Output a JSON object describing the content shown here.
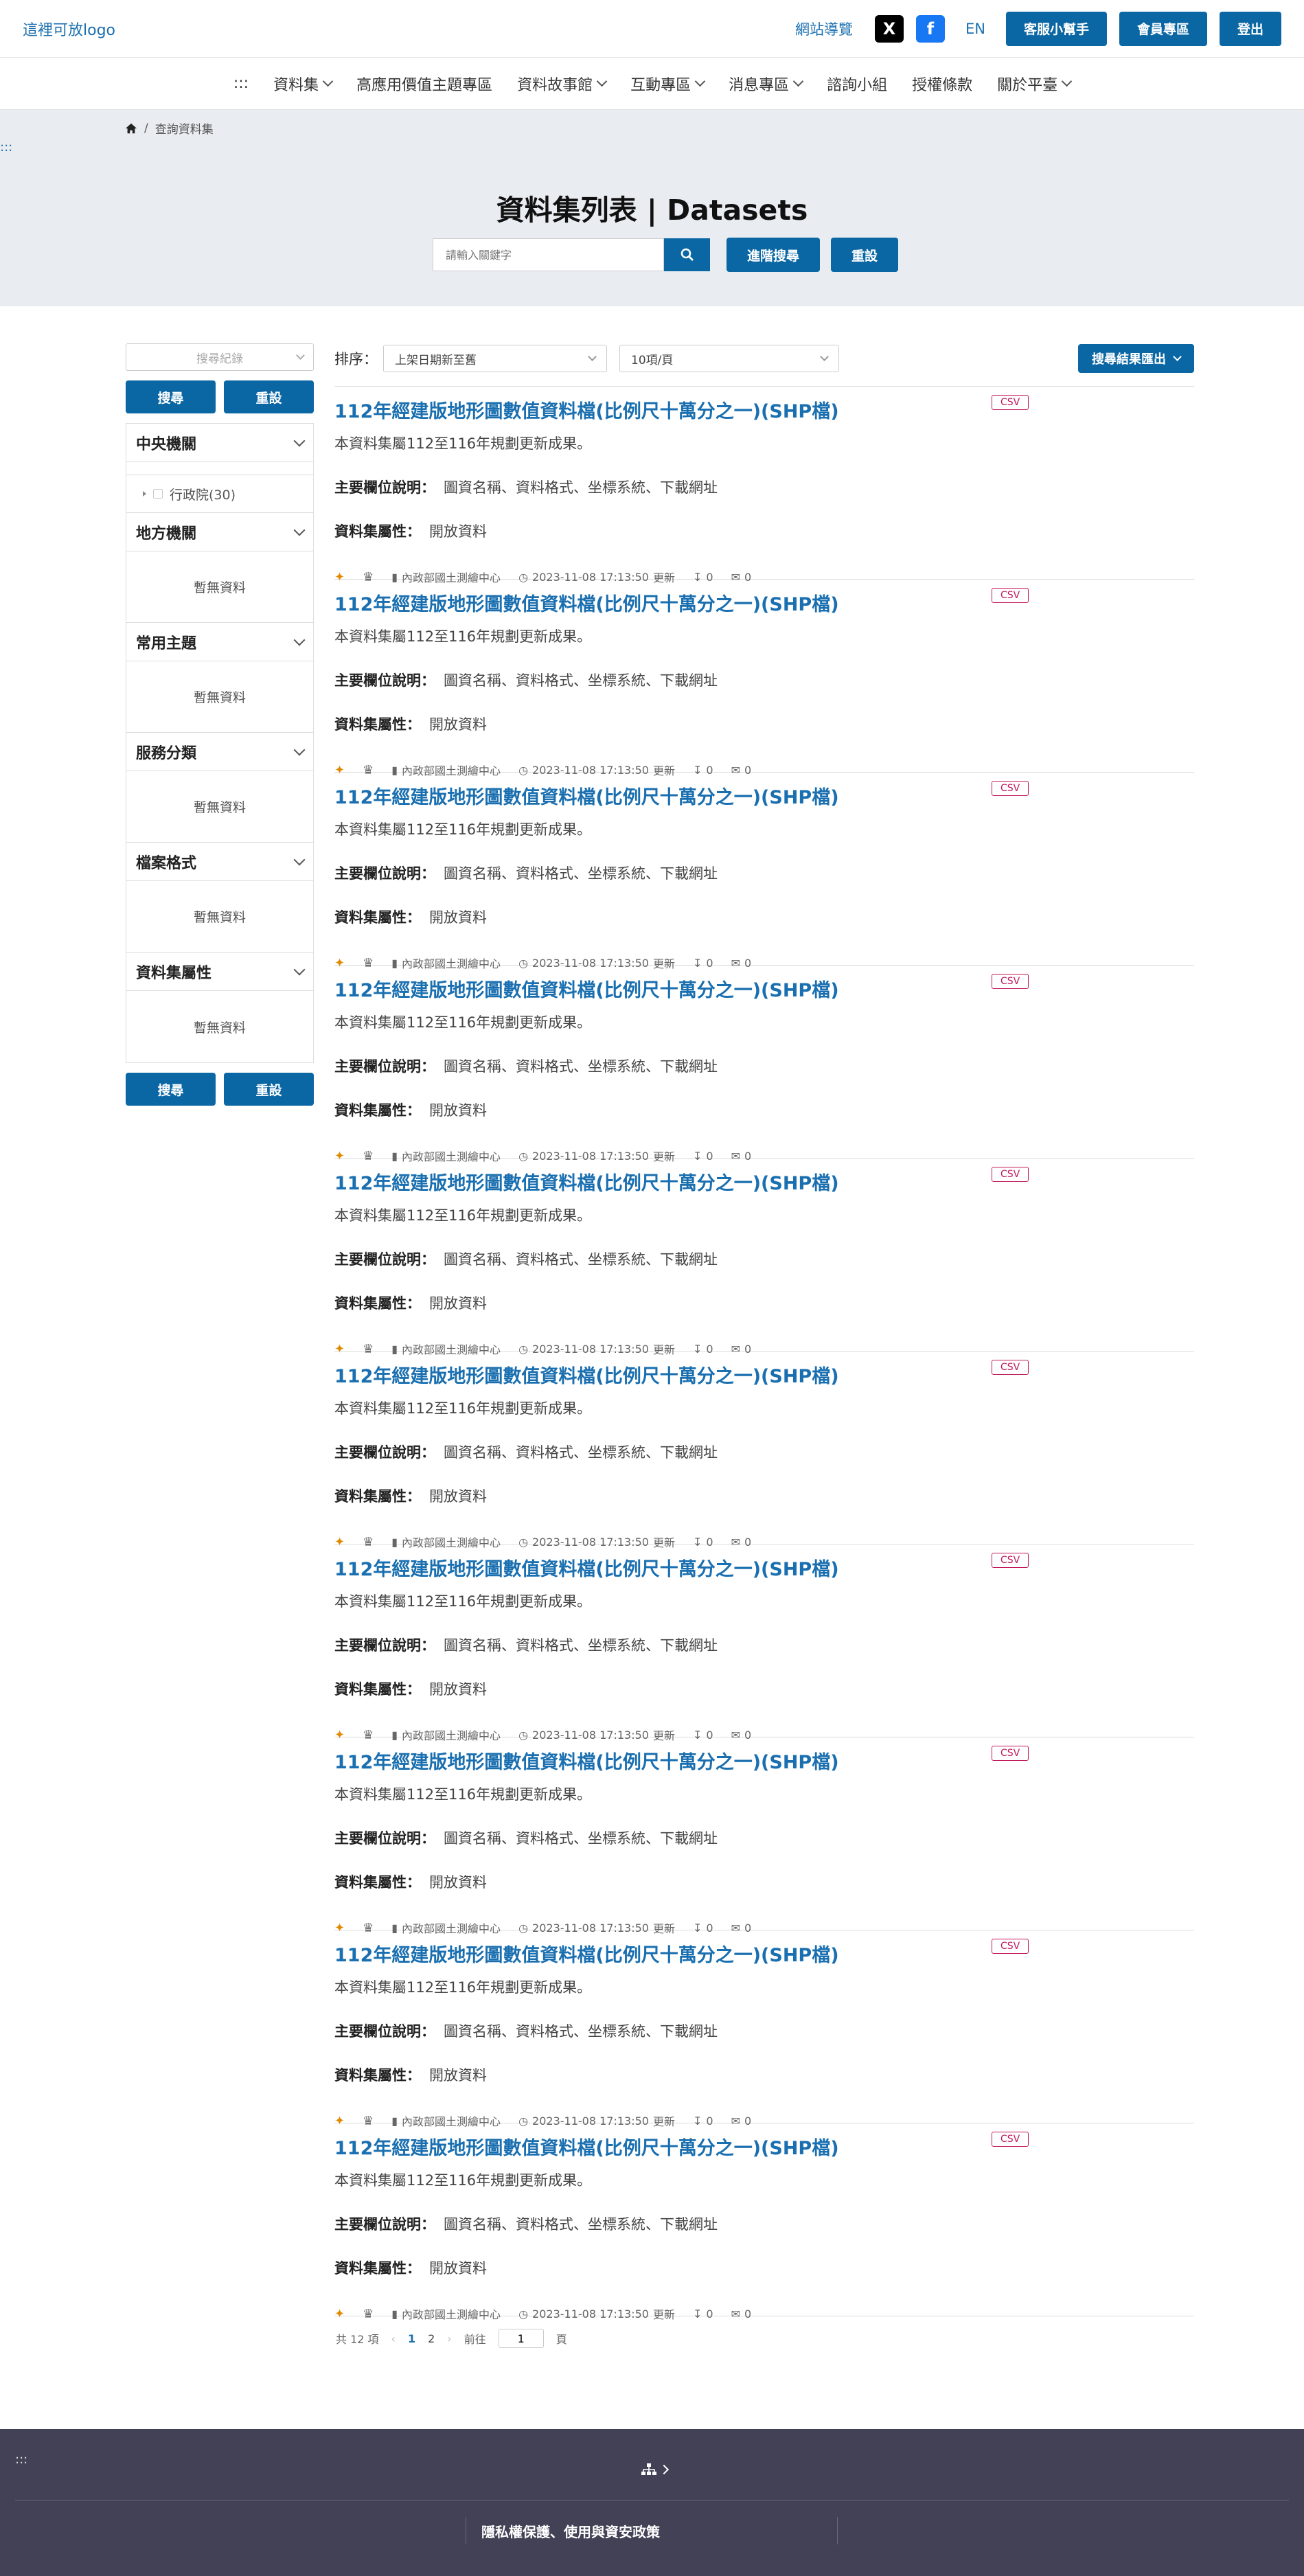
{
  "header": {
    "logo": "這裡可放logo",
    "sitemap": "網站導覽",
    "lang": "EN",
    "buttons": {
      "helper": "客服小幫手",
      "member": "會員專區",
      "logout": "登出"
    },
    "social": {
      "x": "X",
      "facebook": "f"
    }
  },
  "nav": {
    "access_key": ":::",
    "items": [
      {
        "label": "資料集",
        "dropdown": true
      },
      {
        "label": "高應用價值主題專區",
        "dropdown": false
      },
      {
        "label": "資料故事館",
        "dropdown": true
      },
      {
        "label": "互動專區",
        "dropdown": true
      },
      {
        "label": "消息專區",
        "dropdown": true
      },
      {
        "label": "諮詢小組",
        "dropdown": false
      },
      {
        "label": "授權條款",
        "dropdown": false
      },
      {
        "label": "關於平臺",
        "dropdown": true
      }
    ]
  },
  "breadcrumb": {
    "separator": "/",
    "current": "查詢資料集"
  },
  "hero": {
    "access_key": ":::",
    "title": "資料集列表 | Datasets",
    "search_placeholder": "請輸入關鍵字",
    "advanced": "進階搜尋",
    "reset": "重設"
  },
  "sidebar": {
    "history_placeholder": "搜尋紀錄",
    "search": "搜尋",
    "reset": "重設",
    "facets": [
      {
        "title": "中央機關",
        "items": [
          "行政院(30)"
        ],
        "empty": ""
      },
      {
        "title": "地方機關",
        "items": [],
        "empty": "暫無資料"
      },
      {
        "title": "常用主題",
        "items": [],
        "empty": "暫無資料"
      },
      {
        "title": "服務分類",
        "items": [],
        "empty": "暫無資料"
      },
      {
        "title": "檔案格式",
        "items": [],
        "empty": "暫無資料"
      },
      {
        "title": "資料集屬性",
        "items": [],
        "empty": "暫無資料"
      }
    ]
  },
  "results": {
    "sort_label": "排序：",
    "sort_value": "上架日期新至舊",
    "page_size": "10項/頁",
    "export": "搜尋結果匯出",
    "field_label": "主要欄位說明：",
    "attr_label": "資料集屬性：",
    "updated_suffix": "更新",
    "items": [
      {
        "title": "112年經建版地形圖數值資料檔(比例尺十萬分之一)(SHP檔)",
        "format": "CSV",
        "desc": "本資料集屬112至116年規劃更新成果。",
        "fields": "圖資名稱、資料格式、坐標系統、下載網址",
        "attr": "開放資料",
        "org": "內政部國土測繪中心",
        "updated": "2023-11-08 17:13:50",
        "downloads": "0",
        "comments": "0"
      },
      {
        "title": "112年經建版地形圖數值資料檔(比例尺十萬分之一)(SHP檔)",
        "format": "CSV",
        "desc": "本資料集屬112至116年規劃更新成果。",
        "fields": "圖資名稱、資料格式、坐標系統、下載網址",
        "attr": "開放資料",
        "org": "內政部國土測繪中心",
        "updated": "2023-11-08 17:13:50",
        "downloads": "0",
        "comments": "0"
      },
      {
        "title": "112年經建版地形圖數值資料檔(比例尺十萬分之一)(SHP檔)",
        "format": "CSV",
        "desc": "本資料集屬112至116年規劃更新成果。",
        "fields": "圖資名稱、資料格式、坐標系統、下載網址",
        "attr": "開放資料",
        "org": "內政部國土測繪中心",
        "updated": "2023-11-08 17:13:50",
        "downloads": "0",
        "comments": "0"
      },
      {
        "title": "112年經建版地形圖數值資料檔(比例尺十萬分之一)(SHP檔)",
        "format": "CSV",
        "desc": "本資料集屬112至116年規劃更新成果。",
        "fields": "圖資名稱、資料格式、坐標系統、下載網址",
        "attr": "開放資料",
        "org": "內政部國土測繪中心",
        "updated": "2023-11-08 17:13:50",
        "downloads": "0",
        "comments": "0"
      },
      {
        "title": "112年經建版地形圖數值資料檔(比例尺十萬分之一)(SHP檔)",
        "format": "CSV",
        "desc": "本資料集屬112至116年規劃更新成果。",
        "fields": "圖資名稱、資料格式、坐標系統、下載網址",
        "attr": "開放資料",
        "org": "內政部國土測繪中心",
        "updated": "2023-11-08 17:13:50",
        "downloads": "0",
        "comments": "0"
      },
      {
        "title": "112年經建版地形圖數值資料檔(比例尺十萬分之一)(SHP檔)",
        "format": "CSV",
        "desc": "本資料集屬112至116年規劃更新成果。",
        "fields": "圖資名稱、資料格式、坐標系統、下載網址",
        "attr": "開放資料",
        "org": "內政部國土測繪中心",
        "updated": "2023-11-08 17:13:50",
        "downloads": "0",
        "comments": "0"
      },
      {
        "title": "112年經建版地形圖數值資料檔(比例尺十萬分之一)(SHP檔)",
        "format": "CSV",
        "desc": "本資料集屬112至116年規劃更新成果。",
        "fields": "圖資名稱、資料格式、坐標系統、下載網址",
        "attr": "開放資料",
        "org": "內政部國土測繪中心",
        "updated": "2023-11-08 17:13:50",
        "downloads": "0",
        "comments": "0"
      },
      {
        "title": "112年經建版地形圖數值資料檔(比例尺十萬分之一)(SHP檔)",
        "format": "CSV",
        "desc": "本資料集屬112至116年規劃更新成果。",
        "fields": "圖資名稱、資料格式、坐標系統、下載網址",
        "attr": "開放資料",
        "org": "內政部國土測繪中心",
        "updated": "2023-11-08 17:13:50",
        "downloads": "0",
        "comments": "0"
      },
      {
        "title": "112年經建版地形圖數值資料檔(比例尺十萬分之一)(SHP檔)",
        "format": "CSV",
        "desc": "本資料集屬112至116年規劃更新成果。",
        "fields": "圖資名稱、資料格式、坐標系統、下載網址",
        "attr": "開放資料",
        "org": "內政部國土測繪中心",
        "updated": "2023-11-08 17:13:50",
        "downloads": "0",
        "comments": "0"
      },
      {
        "title": "112年經建版地形圖數值資料檔(比例尺十萬分之一)(SHP檔)",
        "format": "CSV",
        "desc": "本資料集屬112至116年規劃更新成果。",
        "fields": "圖資名稱、資料格式、坐標系統、下載網址",
        "attr": "開放資料",
        "org": "內政部國土測繪中心",
        "updated": "2023-11-08 17:13:50",
        "downloads": "0",
        "comments": "0"
      }
    ]
  },
  "pagination": {
    "total": "共 12 項",
    "pages": [
      "1",
      "2"
    ],
    "current": "1",
    "goto_label": "前往",
    "goto_value": "1",
    "page_suffix": "頁"
  },
  "footer": {
    "access_key": ":::",
    "links": "隱私權保護、使用與資安政策"
  },
  "colors": {
    "primary": "#0a67a3",
    "link": "#1a6fb0",
    "badge": "#c2185b",
    "footer_bg": "#434155",
    "hero_bg": "#e9edf2"
  },
  "icons": [
    "home-icon",
    "search-icon",
    "chevron-down-icon",
    "award-icon",
    "crown-icon",
    "bookmark-icon",
    "clock-icon",
    "download-icon",
    "comments-icon",
    "sitemap-icon"
  ]
}
